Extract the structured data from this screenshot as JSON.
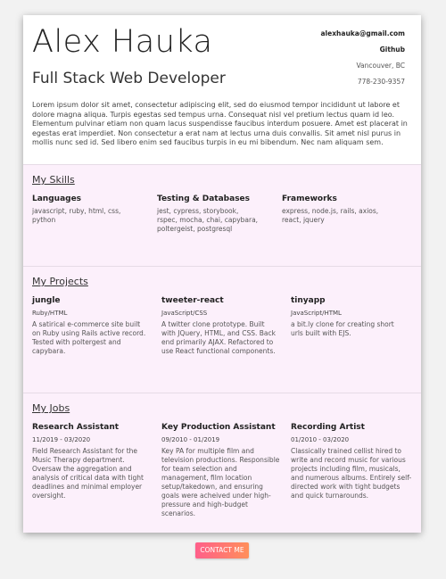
{
  "header": {
    "name": "Alex Hauka",
    "title": "Full Stack Web Developer",
    "email": "alexhauka@gmail.com",
    "github": "Github",
    "location": "Vancouver, BC",
    "phone": "778-230-9357"
  },
  "intro": "Lorem ipsum dolor sit amet, consectetur adipiscing elit, sed do eiusmod tempor incididunt ut labore et dolore magna aliqua. Turpis egestas sed tempus urna. Consequat nisl vel pretium lectus quam id leo. Elementum pulvinar etiam non quam lacus suspendisse faucibus interdum posuere. Amet est placerat in egestas erat imperdiet. Non consectetur a erat nam at lectus urna duis convallis. Sit amet nisl purus in mollis nunc sed id. Sed libero enim sed faucibus turpis in eu mi bibendum. Nec nam aliquam sem.",
  "skills": {
    "heading": "My Skills",
    "columns": [
      {
        "title": "Languages",
        "desc": "javascript, ruby, html, css, python"
      },
      {
        "title": "Testing & Databases",
        "desc": "jest, cypress, storybook, rspec, mocha, chai, capybara, poltergeist, postgresql"
      },
      {
        "title": "Frameworks",
        "desc": "express, node.js, rails, axios, react, jquery"
      }
    ]
  },
  "projects": {
    "heading": "My Projects",
    "items": [
      {
        "title": "jungle",
        "sub": "Ruby/HTML",
        "desc": "A satirical e-commerce site built on Ruby using Rails active record. Tested with poltergest and capybara."
      },
      {
        "title": "tweeter-react",
        "sub": "JavaScript/CSS",
        "desc": "A twitter clone prototype. Built with JQuery, HTML, and CSS. Back end primarily AJAX. Refactored to use React functional components."
      },
      {
        "title": "tinyapp",
        "sub": "JavaScript/HTML",
        "desc": "a bit.ly clone for creating short urls built with EJS."
      }
    ]
  },
  "jobs": {
    "heading": "My Jobs",
    "items": [
      {
        "title": "Research Assistant",
        "sub": "11/2019 - 03/2020",
        "desc": "Field Research Assistant for the Music Therapy department. Oversaw the aggregation and analysis of critical data with tight deadlines and minimal employer oversight."
      },
      {
        "title": "Key Production Assistant",
        "sub": "09/2010 - 01/2019",
        "desc": "Key PA for multiple film and television productions. Responsible for team selection and management, film location setup/takedown, and ensuring goals were acheived under high-pressure and high-budget scenarios."
      },
      {
        "title": "Recording Artist",
        "sub": "01/2010 - 03/2020",
        "desc": "Classically trained cellist hired to write and record music for various projects including film, musicals, and numerous albums. Entirely self-directed work with tight budgets and quick turnarounds."
      }
    ]
  },
  "contact_button": "CONTACT ME"
}
